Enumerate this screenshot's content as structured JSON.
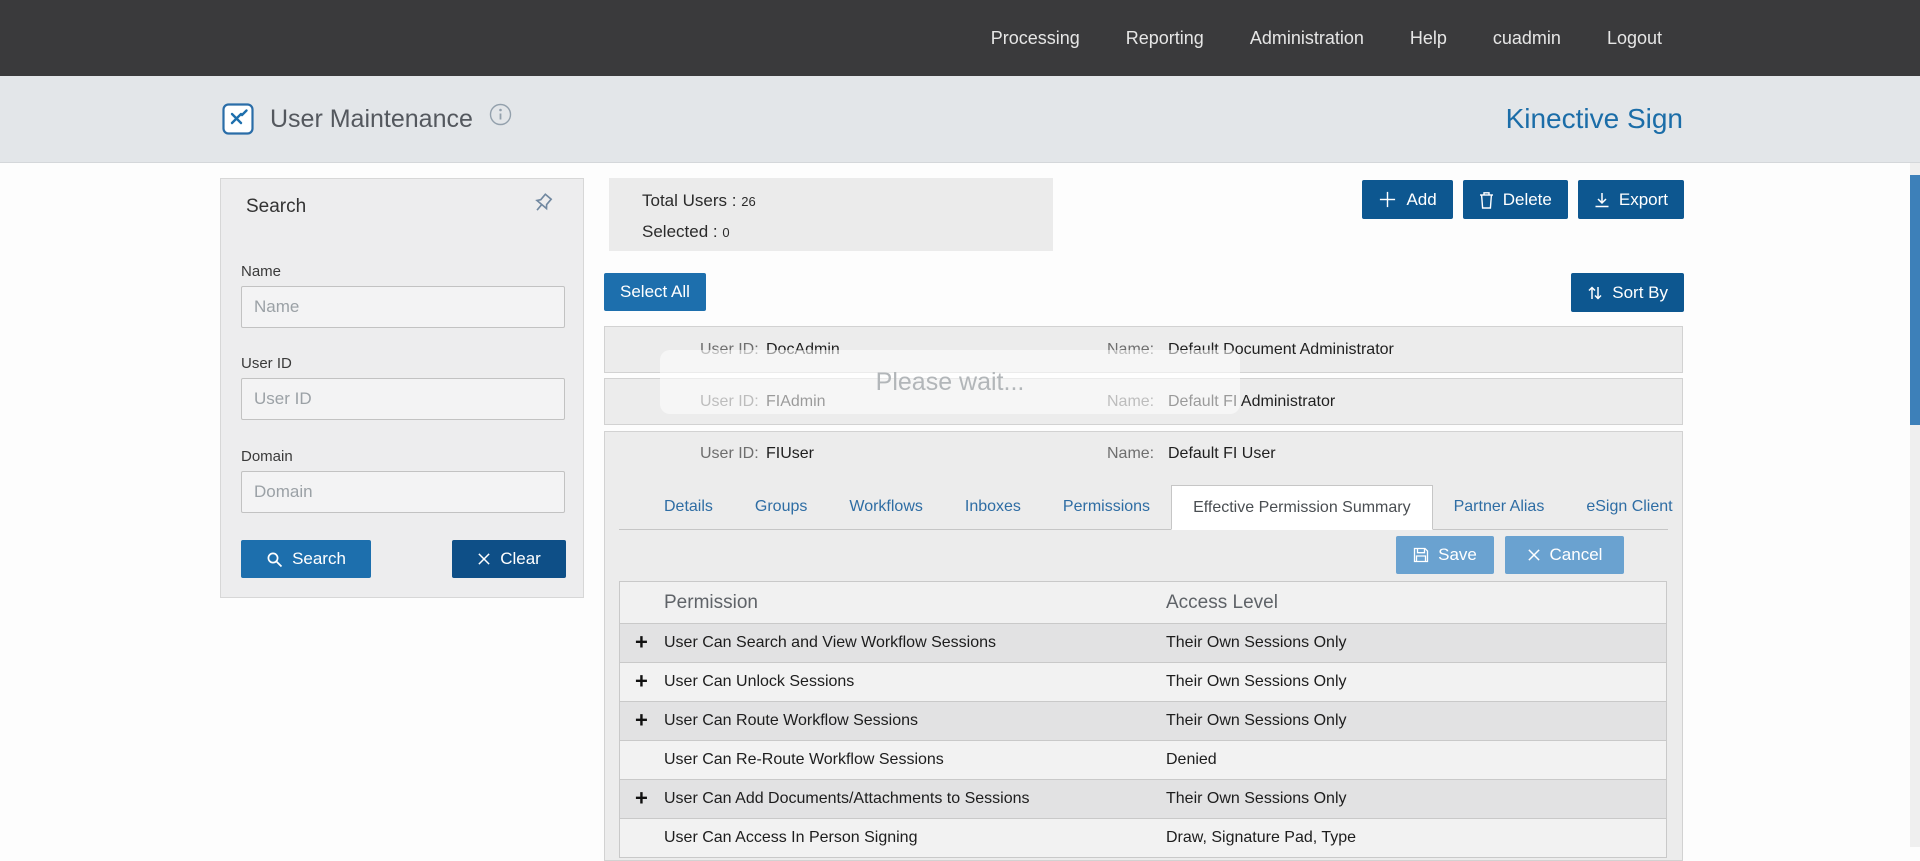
{
  "topnav": {
    "items": [
      "Processing",
      "Reporting",
      "Administration",
      "Help",
      "cuadmin",
      "Logout"
    ]
  },
  "header": {
    "title": "User Maintenance",
    "brand": "Kinective Sign"
  },
  "search_panel": {
    "title": "Search",
    "fields": [
      {
        "label": "Name",
        "placeholder": "Name"
      },
      {
        "label": "User ID",
        "placeholder": "User ID"
      },
      {
        "label": "Domain",
        "placeholder": "Domain"
      }
    ],
    "search_label": "Search",
    "clear_label": "Clear"
  },
  "stats": {
    "total_label": "Total Users :",
    "total_value": "26",
    "selected_label": "Selected :",
    "selected_value": "0"
  },
  "toolbar": {
    "add_label": "Add",
    "delete_label": "Delete",
    "export_label": "Export",
    "select_all_label": "Select All",
    "sort_by_label": "Sort By"
  },
  "overlay": {
    "text": "Please wait..."
  },
  "user_list": {
    "labels": {
      "user_id": "User ID:",
      "name": "Name:"
    },
    "users": [
      {
        "id": "DocAdmin",
        "name": "Default Document Administrator"
      },
      {
        "id": "FIAdmin",
        "name": "Default FI Administrator"
      },
      {
        "id": "FIUser",
        "name": "Default FI User"
      }
    ]
  },
  "detail": {
    "tabs": [
      "Details",
      "Groups",
      "Workflows",
      "Inboxes",
      "Permissions",
      "Effective Permission Summary",
      "Partner Alias",
      "eSign Client"
    ],
    "active_tab": "Effective Permission Summary",
    "save_label": "Save",
    "cancel_label": "Cancel",
    "expand_glyph": "+",
    "table": {
      "headers": [
        "Permission",
        "Access Level"
      ],
      "rows": [
        {
          "expandable": true,
          "permission": "User Can Search and View Workflow Sessions",
          "access": "Their Own Sessions Only"
        },
        {
          "expandable": true,
          "permission": "User Can Unlock Sessions",
          "access": "Their Own Sessions Only"
        },
        {
          "expandable": true,
          "permission": "User Can Route Workflow Sessions",
          "access": "Their Own Sessions Only"
        },
        {
          "expandable": false,
          "permission": "User Can Re-Route Workflow Sessions",
          "access": "Denied"
        },
        {
          "expandable": true,
          "permission": "User Can Add Documents/Attachments to Sessions",
          "access": "Their Own Sessions Only"
        },
        {
          "expandable": false,
          "permission": "User Can Access In Person Signing",
          "access": "Draw, Signature Pad, Type"
        }
      ]
    }
  },
  "icons": {
    "logo": "x-square-logo",
    "info": "info-circle",
    "pin": "push-pin",
    "search": "magnifier",
    "clear": "x-mark",
    "add": "plus",
    "delete": "trash",
    "export": "download-arrow",
    "sort": "up-down-arrows",
    "save": "floppy-disk",
    "cancel": "x-mark",
    "expand": "plus"
  },
  "colors": {
    "topbar": "#3a3a3c",
    "header_bg": "#e3e6e9",
    "brand_blue": "#1b6da8",
    "button_blue": "#1d6fad",
    "dark_blue": "#0d5790",
    "light_blue": "#6aa2d0"
  }
}
